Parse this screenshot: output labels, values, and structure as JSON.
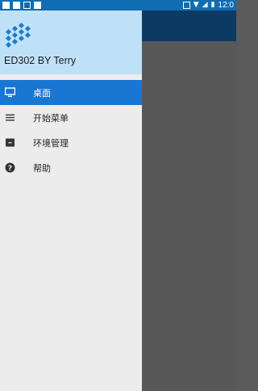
{
  "status_bar": {
    "time": "12:0",
    "icons": [
      "notification-square-icon",
      "notification-square-icon",
      "notification-square-icon",
      "android-icon",
      "picture-icon",
      "wifi-icon",
      "signal-icon",
      "battery-icon"
    ]
  },
  "drawer": {
    "title": "ED302 BY Terry",
    "items": [
      {
        "label": "桌面",
        "icon": "monitor-icon",
        "active": true
      },
      {
        "label": "开始菜单",
        "icon": "menu-icon",
        "active": false
      },
      {
        "label": "环境管理",
        "icon": "folder-icon",
        "active": false
      },
      {
        "label": "帮助",
        "icon": "help-icon",
        "active": false
      }
    ]
  },
  "colors": {
    "status_bar": "#0f6db0",
    "drawer_header": "#bfe1f8",
    "active_item": "#1976d2",
    "content_header": "#0b3b63",
    "content_body": "#585858"
  }
}
